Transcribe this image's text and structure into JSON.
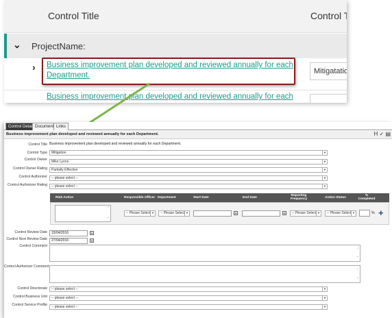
{
  "list": {
    "col_title": "Control Title",
    "col_type": "Control Ty",
    "group_label": "ProjectName:",
    "item_title": "Business improvement plan developed and reviewed annually for each Department.",
    "item_type": "Mitigatatio",
    "item2_title": "Business improvement plan developed and reviewed annually for each"
  },
  "detail": {
    "tabs": [
      "Control Details",
      "Documents",
      "Links"
    ],
    "header_title": "Business improvement plan developed and reviewed annually for each Department.",
    "header_icons": "H ✓ ▤",
    "fields": {
      "control_title_label": "Control Title",
      "control_title_value": "Business improvement plan developed and reviewed annually for each Department.",
      "control_type_label": "Control Type",
      "control_type_value": "Mitigation",
      "control_owner_label": "Control Owner",
      "control_owner_value": "Mike Lyons",
      "owner_rating_label": "Control Owner Rating",
      "owner_rating_value": "Partially Effective",
      "authorizer_label": "Control Authorizer",
      "authorizer_value": "-- please select --",
      "authorizer_rating_label": "Control Authorizer Rating",
      "authorizer_rating_value": "-- please select --"
    },
    "grid": {
      "headers": {
        "risk_action": "Risk Action",
        "responsible_officer": "Responsible Officer",
        "department": "Department",
        "start_date": "Start Date",
        "end_date": "End Date",
        "reporting_frequency": "Reporting Frequency",
        "action_status": "Action Status",
        "pct_completed": "% Completed"
      },
      "row": {
        "officer_value": "-- Please Select",
        "department_value": "-- Please Select",
        "frequency_value": "-- Please Select",
        "status_value": "-- Please Select",
        "pct_symbol": "%"
      }
    },
    "review": {
      "review_date_label": "Control Review Date",
      "review_date_value": "15/04/2016",
      "next_review_label": "Control Next Review Date",
      "next_review_value": "27/04/2016",
      "comment_label": "Control Comment",
      "auth_comment_label": "Control Authorizer Comment",
      "directorate_label": "Control Directorate",
      "directorate_value": "-- please select --",
      "business_unit_label": "Control Business Unit",
      "business_unit_value": "-- please select --",
      "service_profile_label": "Control Service Profile",
      "service_profile_value": "-- please select --"
    }
  },
  "colors": {
    "accent": "#1a9c8c",
    "highlight_border": "#8b1a1a",
    "arrow": "#7ab648",
    "grid_header": "#555555"
  }
}
